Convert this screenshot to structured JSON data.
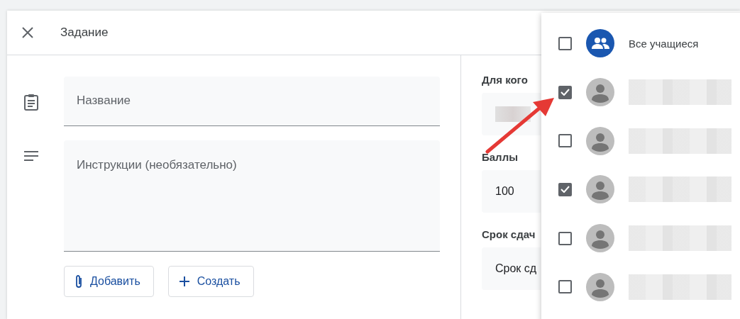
{
  "dialog": {
    "title": "Задание"
  },
  "form": {
    "title_field": {
      "placeholder": "Название"
    },
    "instructions_field": {
      "placeholder": "Инструкции (необязательно)"
    },
    "buttons": [
      {
        "kind": "attach",
        "label": "Добавить"
      },
      {
        "kind": "create",
        "label": "Создать"
      }
    ]
  },
  "settings": {
    "for_whom": {
      "label": "Для кого"
    },
    "points": {
      "label": "Баллы",
      "value": "100"
    },
    "due": {
      "label": "Срок сдач",
      "value": "Срок сд"
    }
  },
  "students_menu": [
    {
      "kind": "all",
      "label": "Все учащиеся",
      "checked": false
    },
    {
      "kind": "student",
      "checked": true
    },
    {
      "kind": "student",
      "checked": false
    },
    {
      "kind": "student",
      "checked": true
    },
    {
      "kind": "student",
      "checked": false
    },
    {
      "kind": "student",
      "checked": false
    }
  ]
}
